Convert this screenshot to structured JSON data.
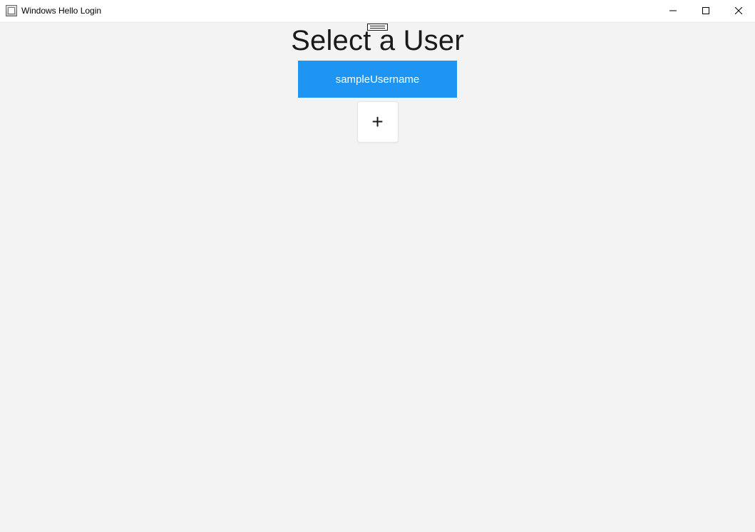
{
  "window": {
    "title": "Windows Hello Login"
  },
  "main": {
    "heading": "Select a User",
    "users": [
      {
        "label": "sampleUsername"
      }
    ],
    "add_label": "+"
  },
  "colors": {
    "accent": "#1e95f3",
    "background": "#f3f3f3"
  }
}
